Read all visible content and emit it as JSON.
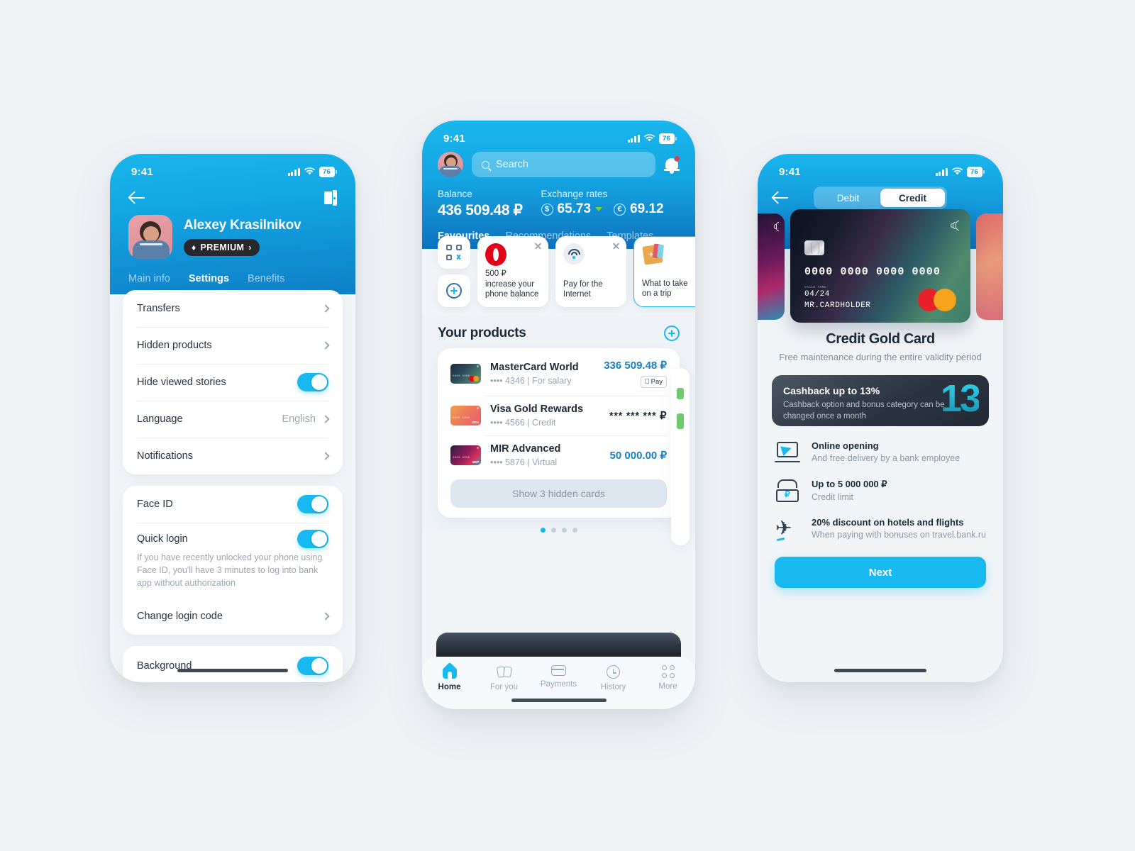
{
  "settings_screen": {
    "status": {
      "time": "9:41",
      "battery": "76"
    },
    "nav": {
      "back_icon": "back-arrow-icon",
      "exit_icon": "exit-door-icon"
    },
    "profile": {
      "name": "Alexey Krasilnikov",
      "badge": "PREMIUM",
      "badge_chevron": "›"
    },
    "tabs": [
      {
        "label": "Main info",
        "active": false
      },
      {
        "label": "Settings",
        "active": true
      },
      {
        "label": "Benefits",
        "active": false
      }
    ],
    "group1": [
      {
        "label": "Transfers",
        "type": "chevron"
      },
      {
        "label": "Hidden products",
        "type": "chevron"
      },
      {
        "label": "Hide viewed stories",
        "type": "toggle",
        "on": true
      },
      {
        "label": "Language",
        "type": "value",
        "value": "English"
      },
      {
        "label": "Notifications",
        "type": "chevron"
      }
    ],
    "group2": [
      {
        "label": "Face ID",
        "type": "toggle",
        "on": true
      },
      {
        "label": "Quick login",
        "type": "toggle",
        "on": true
      }
    ],
    "quick_login_note": "If you have recently unlocked your phone using Face ID, you'll have 3 minutes to log into bank app without authorization",
    "change_login": "Change login code",
    "group3": [
      {
        "label": "Background",
        "type": "toggle",
        "on": true
      }
    ]
  },
  "home_screen": {
    "status": {
      "time": "9:41",
      "battery": "76"
    },
    "search": {
      "placeholder": "Search",
      "icon": "search-icon"
    },
    "notification": {
      "icon": "bell-icon",
      "has_badge": true
    },
    "balance": {
      "label": "Balance",
      "value": "436 509.48 ₽"
    },
    "exchange": {
      "label": "Exchange rates",
      "rates": [
        {
          "currency": "$",
          "value": "65.73",
          "trend": "down"
        },
        {
          "currency": "€",
          "value": "69.12",
          "trend": "none"
        }
      ]
    },
    "tabs": [
      {
        "label": "Favourites",
        "active": true
      },
      {
        "label": "Recommendations",
        "active": false
      },
      {
        "label": "Templates",
        "active": false
      }
    ],
    "mini_actions": [
      {
        "icon": "qr-scan-icon"
      },
      {
        "icon": "plus-circle-icon"
      }
    ],
    "favourites": [
      {
        "icon": "mts-logo-icon",
        "text": "500 ₽\nincrease your\nphone balance",
        "closable": true,
        "selected": false
      },
      {
        "icon": "wifi-icon",
        "text": "Pay for the\nInternet",
        "closable": true,
        "selected": false
      },
      {
        "icon": "passport-icon",
        "text": "What to take\non a trip",
        "closable": false,
        "selected": true
      }
    ],
    "products_section": {
      "title": "Your products",
      "add_icon": "plus-circle-icon"
    },
    "products": [
      {
        "name": "MasterCard World",
        "meta": "•••• 4346 | For salary",
        "amount": "336 509.48 ₽",
        "masked": false,
        "applepay": "Pay",
        "card_style": "mastercard-dark"
      },
      {
        "name": "Visa Gold Rewards",
        "meta": "•••• 4566 | Credit",
        "amount": "*** *** *** ₽",
        "masked": true,
        "applepay": "",
        "card_style": "visa-orange"
      },
      {
        "name": "MIR Advanced",
        "meta": "•••• 5876 | Virtual",
        "amount": "50 000.00 ₽",
        "masked": false,
        "applepay": "",
        "card_style": "mir-purple"
      }
    ],
    "show_hidden": "Show 3 hidden cards",
    "pager": {
      "count": 4,
      "active": 0
    },
    "tabbar": [
      {
        "label": "Home",
        "icon": "home-icon",
        "active": true
      },
      {
        "label": "For you",
        "icon": "cards-icon",
        "active": false
      },
      {
        "label": "Payments",
        "icon": "credit-card-icon",
        "active": false
      },
      {
        "label": "History",
        "icon": "clock-icon",
        "active": false
      },
      {
        "label": "More",
        "icon": "grid-dots-icon",
        "active": false
      }
    ]
  },
  "card_screen": {
    "status": {
      "time": "9:41",
      "battery": "76"
    },
    "back_icon": "back-arrow-icon",
    "segments": [
      {
        "label": "Debit",
        "active": false
      },
      {
        "label": "Credit",
        "active": true
      }
    ],
    "card": {
      "number": "0000 0000 0000 0000",
      "valid_label": "VALID THRU",
      "valid_thru": "04/24",
      "holder": "MR.CARDHOLDER",
      "network": "mastercard-logo-icon",
      "nfc": "contactless-icon"
    },
    "title": "Credit Gold Card",
    "subtitle": "Free maintenance during the entire validity period",
    "cashback": {
      "title": "Cashback up to 13%",
      "subtitle": "Cashback option and bonus category can be changed once a month",
      "number": "13"
    },
    "benefits": [
      {
        "icon": "laptop-send-icon",
        "title": "Online opening",
        "subtitle": "And free delivery by a bank employee"
      },
      {
        "icon": "money-ruble-icon",
        "title": "Up to 5 000 000 ₽",
        "subtitle": "Credit limit"
      },
      {
        "icon": "airplane-icon",
        "title": "20% discount on hotels and flights",
        "subtitle": "When paying with bonuses on travel.bank.ru"
      }
    ],
    "next_button": "Next"
  },
  "colors": {
    "page_bg": "#eff2f5",
    "brand_blue": "#18b9f0",
    "header_blue_dark": "#0d72bf",
    "accent_amount": "#1a7fc1",
    "muted_text": "#9aa6b2",
    "dark_text": "#1d2a36",
    "dark_panel": "#2b3440"
  }
}
